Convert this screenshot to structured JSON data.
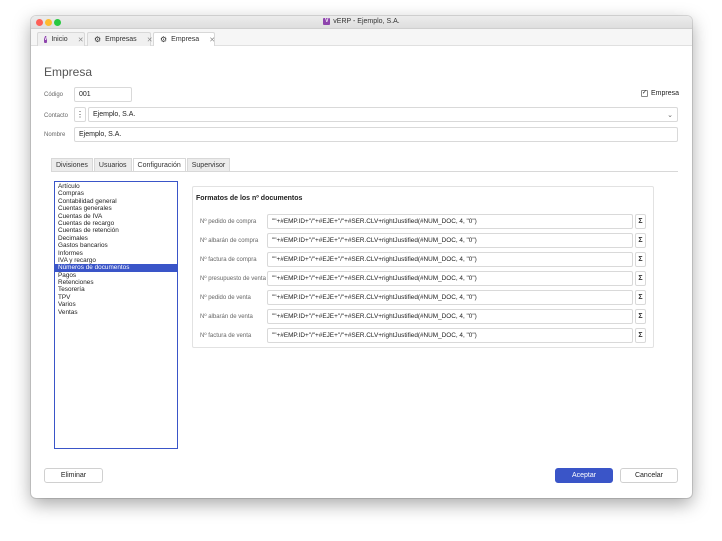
{
  "window": {
    "title": "vERP - Ejemplo, S.A.",
    "app_icon": "V"
  },
  "tabs": [
    {
      "label": "Inicio",
      "icon": "app-icon"
    },
    {
      "label": "Empresas",
      "icon": "gear-icon"
    },
    {
      "label": "Empresa",
      "icon": "gear-icon",
      "active": true
    }
  ],
  "form": {
    "heading": "Empresa",
    "codigo_label": "Código",
    "codigo_value": "001",
    "empresa_checkbox_label": "Empresa",
    "empresa_checked": true,
    "contacto_label": "Contacto",
    "contacto_value": "Ejemplo, S.A.",
    "nombre_label": "Nombre",
    "nombre_value": "Ejemplo, S.A."
  },
  "section_tabs": [
    "Divisiones",
    "Usuarios",
    "Configuración",
    "Supervisor"
  ],
  "active_section_tab": "Configuración",
  "sidebar": {
    "items": [
      "Artículo",
      "Compras",
      "Contabilidad general",
      "Cuentas generales",
      "Cuentas de IVA",
      "Cuentas de recargo",
      "Cuentas de retención",
      "Decimales",
      "Gastos bancarios",
      "Informes",
      "IVA y recargo",
      "Números de documentos",
      "Pagos",
      "Retenciones",
      "Tesorería",
      "TPV",
      "Varios",
      "Ventas"
    ],
    "selected": "Números de documentos"
  },
  "panel": {
    "title": "Formatos de los nº documentos",
    "rows": [
      {
        "label": "Nº pedido de compra",
        "value": "\"\"+#EMP.ID+\"/\"+#EJE+\"/\"+#SER.CLV+rightJustified(#NUM_DOC, 4, \"0\")"
      },
      {
        "label": "Nº albarán de compra",
        "value": "\"\"+#EMP.ID+\"/\"+#EJE+\"/\"+#SER.CLV+rightJustified(#NUM_DOC, 4, \"0\")"
      },
      {
        "label": "Nº factura de compra",
        "value": "\"\"+#EMP.ID+\"/\"+#EJE+\"/\"+#SER.CLV+rightJustified(#NUM_DOC, 4, \"0\")"
      },
      {
        "label": "Nº presupuesto de venta",
        "value": "\"\"+#EMP.ID+\"/\"+#EJE+\"/\"+#SER.CLV+rightJustified(#NUM_DOC, 4, \"0\")"
      },
      {
        "label": "Nº pedido de venta",
        "value": "\"\"+#EMP.ID+\"/\"+#EJE+\"/\"+#SER.CLV+rightJustified(#NUM_DOC, 4, \"0\")"
      },
      {
        "label": "Nº albarán de venta",
        "value": "\"\"+#EMP.ID+\"/\"+#EJE+\"/\"+#SER.CLV+rightJustified(#NUM_DOC, 4, \"0\")"
      },
      {
        "label": "Nº factura de venta",
        "value": "\"\"+#EMP.ID+\"/\"+#EJE+\"/\"+#SER.CLV+rightJustified(#NUM_DOC, 4, \"0\")"
      }
    ],
    "sigma_symbol": "Σ"
  },
  "buttons": {
    "delete": "Eliminar",
    "accept": "Aceptar",
    "cancel": "Cancelar"
  },
  "colors": {
    "accent": "#3a55c8",
    "app_icon": "#8e44ad"
  }
}
